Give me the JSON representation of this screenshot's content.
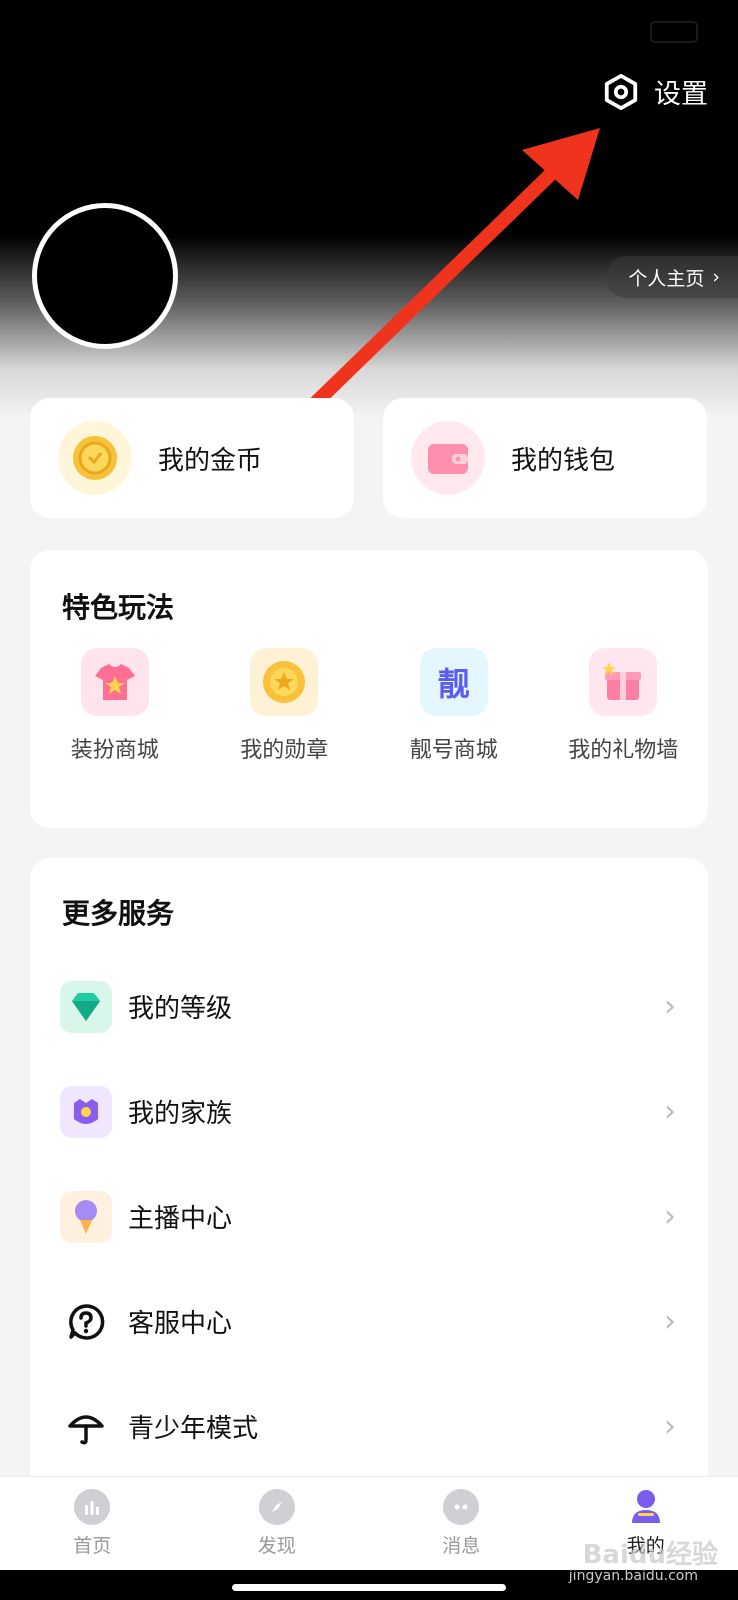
{
  "status_bar": {
    "left_text": "",
    "right_text": ""
  },
  "header": {
    "settings_label": "设置",
    "profile_link_label": "个人主页"
  },
  "quick_cards": [
    {
      "label": "我的金币",
      "icon": "coin-icon"
    },
    {
      "label": "我的钱包",
      "icon": "wallet-icon"
    }
  ],
  "features": {
    "title": "特色玩法",
    "items": [
      {
        "label": "装扮商城",
        "icon": "dress-shop-icon"
      },
      {
        "label": "我的勋章",
        "icon": "medal-icon"
      },
      {
        "label": "靓号商城",
        "icon": "number-shop-icon"
      },
      {
        "label": "我的礼物墙",
        "icon": "gift-icon"
      }
    ]
  },
  "services": {
    "title": "更多服务",
    "items": [
      {
        "label": "我的等级",
        "icon": "diamond-icon"
      },
      {
        "label": "我的家族",
        "icon": "family-badge-icon"
      },
      {
        "label": "主播中心",
        "icon": "microphone-icon"
      },
      {
        "label": "客服中心",
        "icon": "help-icon"
      },
      {
        "label": "青少年模式",
        "icon": "umbrella-icon"
      }
    ]
  },
  "tabbar": {
    "items": [
      {
        "label": "首页",
        "icon": "home-icon"
      },
      {
        "label": "发现",
        "icon": "discover-icon"
      },
      {
        "label": "消息",
        "icon": "message-icon"
      },
      {
        "label": "我的",
        "icon": "profile-icon",
        "active": true
      }
    ]
  },
  "watermark": {
    "text": "Baidu经验",
    "url": "jingyan.baidu.com"
  },
  "colors": {
    "accent": "#7b5cf0",
    "arrow": "#f0331c",
    "background": "#f4f4f6"
  }
}
